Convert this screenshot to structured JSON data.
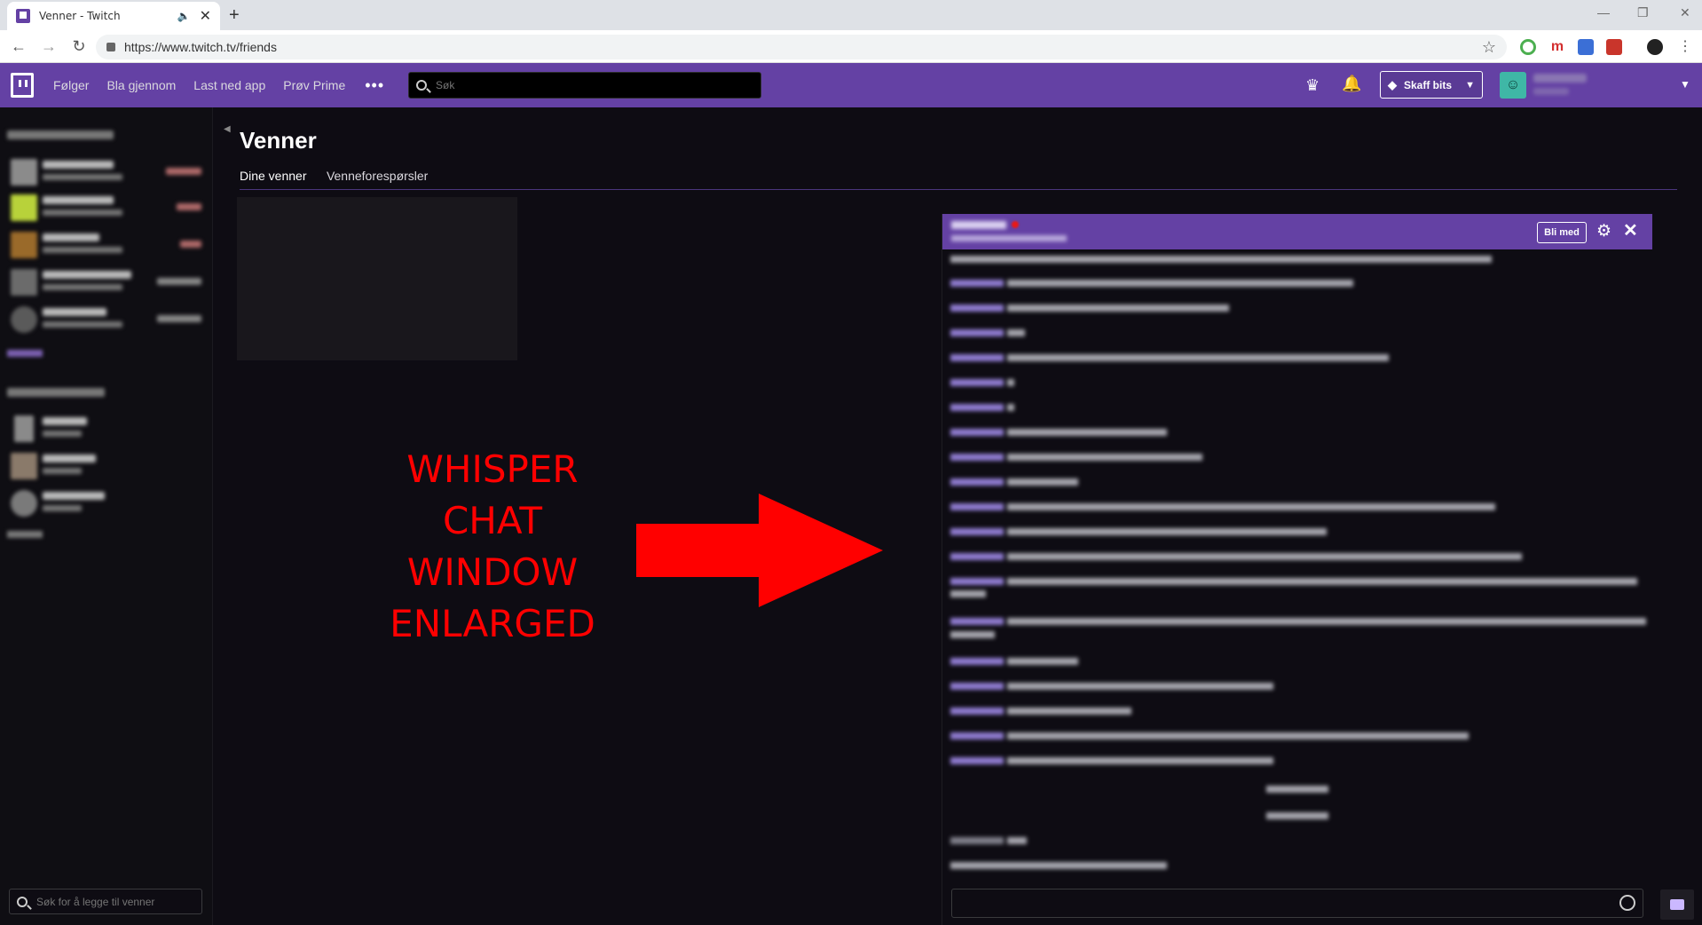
{
  "browser": {
    "tab_title": "Venner - Twitch",
    "new_tab": "+",
    "url": "https://www.twitch.tv/friends",
    "close_symbol": "✕",
    "speaker_symbol": "🔈"
  },
  "topnav": {
    "links": [
      "Følger",
      "Bla gjennom",
      "Last ned app",
      "Prøv Prime"
    ],
    "more": "•••",
    "search_placeholder": "Søk",
    "bits_label": "Skaff bits"
  },
  "sidebar": {
    "friend_search_placeholder": "Søk for å legge til venner"
  },
  "main": {
    "title": "Venner",
    "tabs": [
      "Dine venner",
      "Venneforespørsler"
    ]
  },
  "annotation": {
    "lines": [
      "WHISPER",
      "CHAT",
      "WINDOW",
      "ENLARGED"
    ],
    "color": "#ff0000"
  },
  "whisper": {
    "join_label": "Bli med"
  },
  "colors": {
    "brand": "#6441a4",
    "background": "#0e0c13"
  }
}
